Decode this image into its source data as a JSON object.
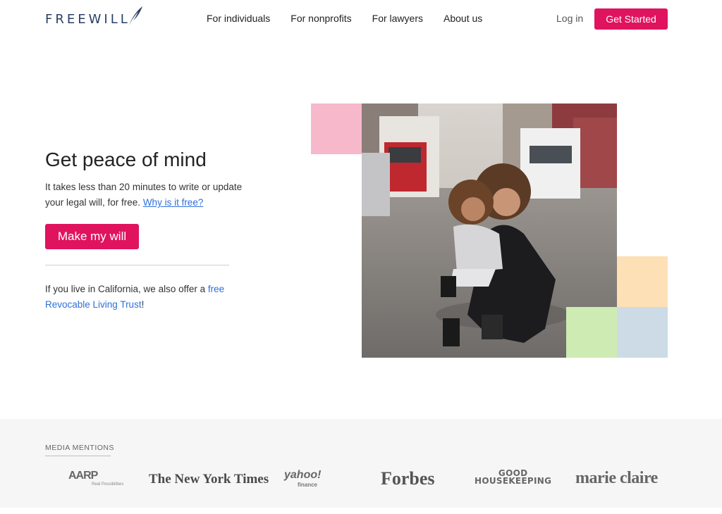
{
  "header": {
    "logo_text": "FREEWILL",
    "nav": [
      {
        "label": "For individuals"
      },
      {
        "label": "For nonprofits"
      },
      {
        "label": "For lawyers"
      },
      {
        "label": "About us"
      }
    ],
    "login_label": "Log in",
    "cta_label": "Get Started"
  },
  "hero": {
    "title": "Get peace of mind",
    "desc_before": "It takes less than 20 minutes to write or update your legal will, for free. ",
    "desc_link": "Why is it free?",
    "button_label": "Make my will",
    "ca_text": "If you live in California, we also offer a ",
    "ca_link": "free Revocable Living Trust",
    "ca_after": "!"
  },
  "colors": {
    "brand": "#e0135f",
    "link": "#2f6fdc",
    "block_pink": "#f7b8cc",
    "block_orange": "#fde0b6",
    "block_green": "#cdebb3",
    "block_blue": "#ccdbe5"
  },
  "media": {
    "title": "MEDIA MENTIONS",
    "logos": {
      "aarp": "AARP",
      "aarp_sub": "Real Possibilities",
      "nyt": "The New York Times",
      "yahoo": "yahoo!",
      "yahoo_sub": "finance",
      "forbes": "Forbes",
      "gh_line1": "GOOD",
      "gh_line2": "HOUSEKEEPING",
      "marieclaire": "marie claire"
    }
  }
}
